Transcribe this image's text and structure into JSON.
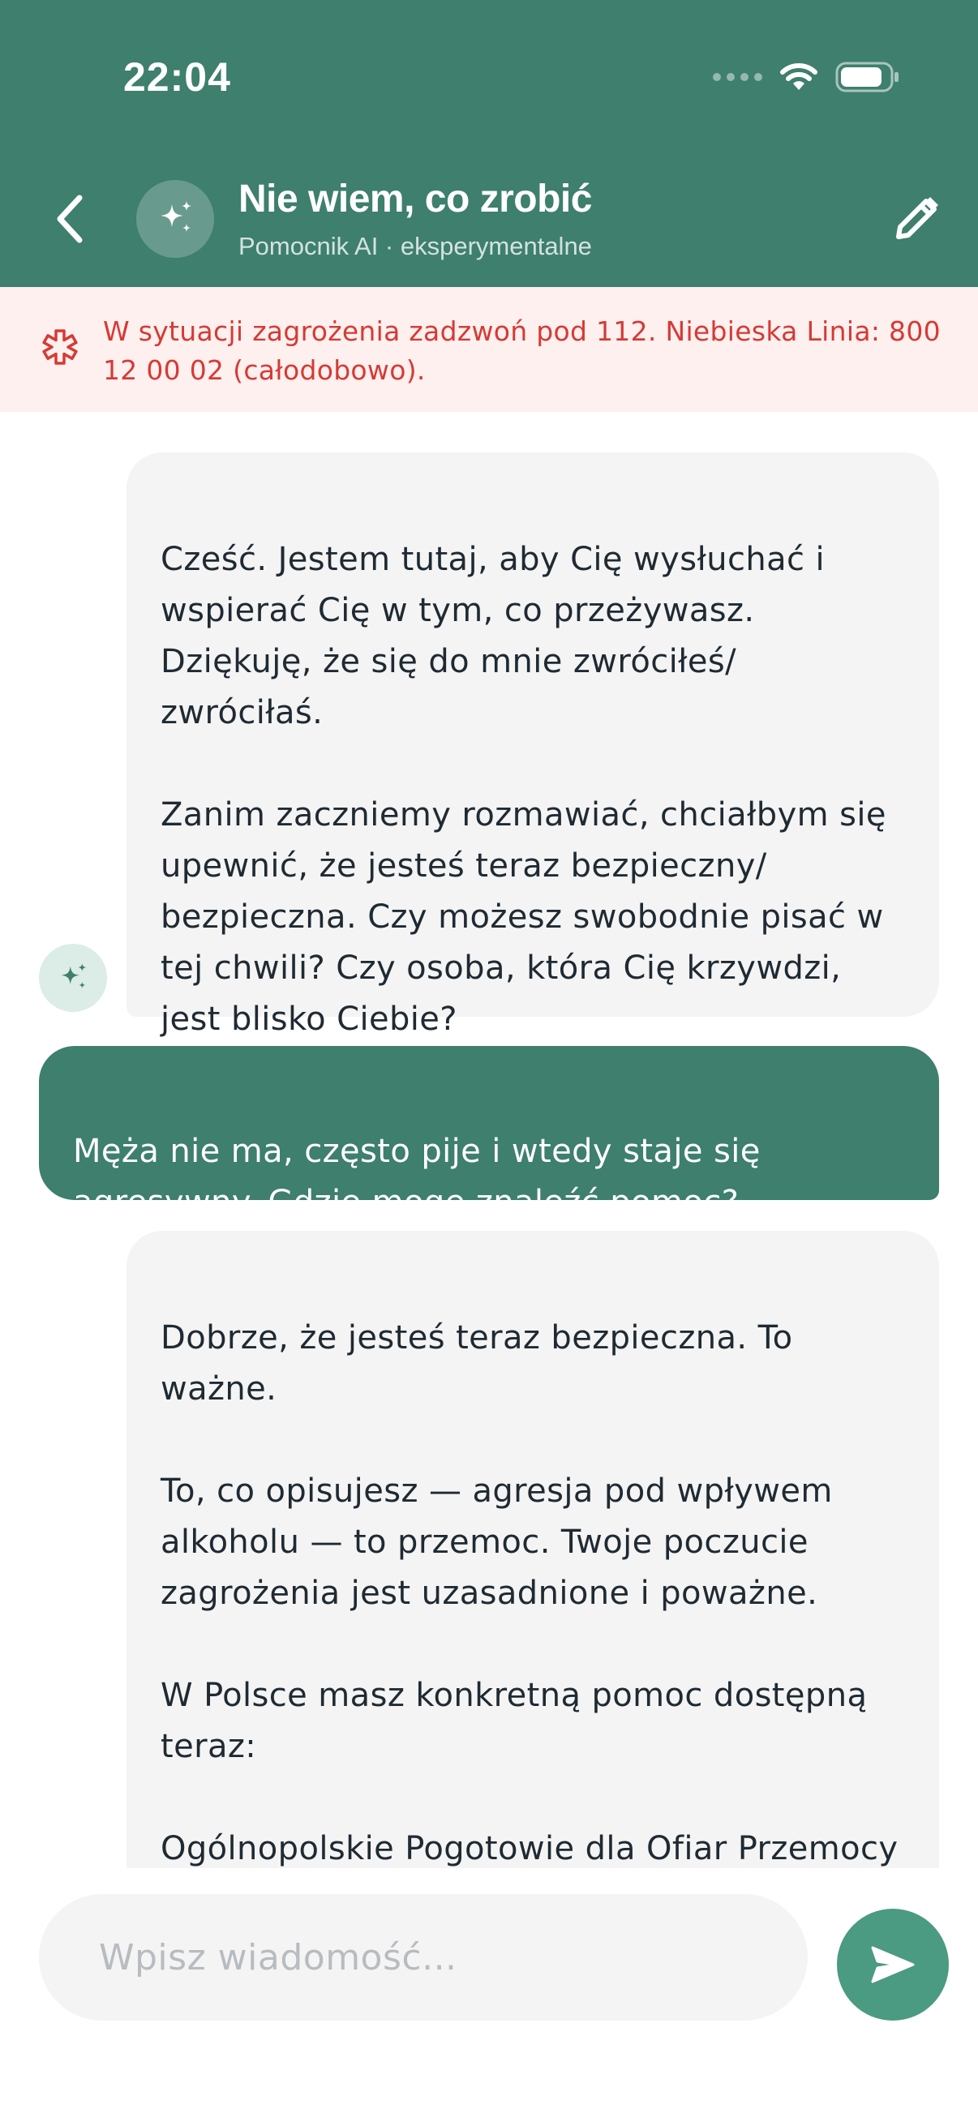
{
  "status_bar": {
    "time": "22:04"
  },
  "header": {
    "title": "Nie wiem, co zrobić",
    "subtitle": "Pomocnik AI · eksperymentalne",
    "back_icon": "chevron-left-icon",
    "avatar_icon": "sparkles-icon",
    "edit_icon": "pencil-icon"
  },
  "alert": {
    "text": "W sytuacji zagrożenia zadzwoń pod 112. Niebieska Linia: 800 12 00 02 (całodobowo).",
    "icon": "medical-asterisk-icon",
    "color": "#d63a35"
  },
  "messages": [
    {
      "role": "assistant",
      "text": "Cześć. Jestem tutaj, aby Cię wysłuchać i wspierać Cię w tym, co przeżywasz. Dziękuję, że się do mnie zwróciłeś/ zwróciłaś.\n\nZanim zaczniemy rozmawiać, chciałbym się upewnić, że jesteś teraz bezpieczny/ bezpieczna. Czy możesz swobodnie pisać w tej chwili? Czy osoba, która Cię krzywdzi, jest blisko Ciebie?"
    },
    {
      "role": "user",
      "text": "Męża nie ma, często pije i wtedy staje się agresywny. Gdzie mogę znaleźć pomoc?"
    },
    {
      "role": "assistant",
      "text": "Dobrze, że jesteś teraz bezpieczna. To ważne.\n\nTo, co opisujesz — agresja pod wpływem alkoholu — to przemoc. Twoje poczucie zagrożenia jest uzasadnione i poważne.\n\nW Polsce masz konkretną pomoc dostępną teraz:\n\nOgólnopolskie Pogotowie dla Ofiar Przemocy w Rodzinie \"Niebieska Linia\" —"
    }
  ],
  "composer": {
    "placeholder": "Wpisz wiadomość...",
    "value": "",
    "send_icon": "send-icon"
  },
  "colors": {
    "primary": "#3e7f6d",
    "send_button": "#4b9a82",
    "ai_bubble": "#f4f4f4",
    "alert_background": "#fdf0ee"
  }
}
